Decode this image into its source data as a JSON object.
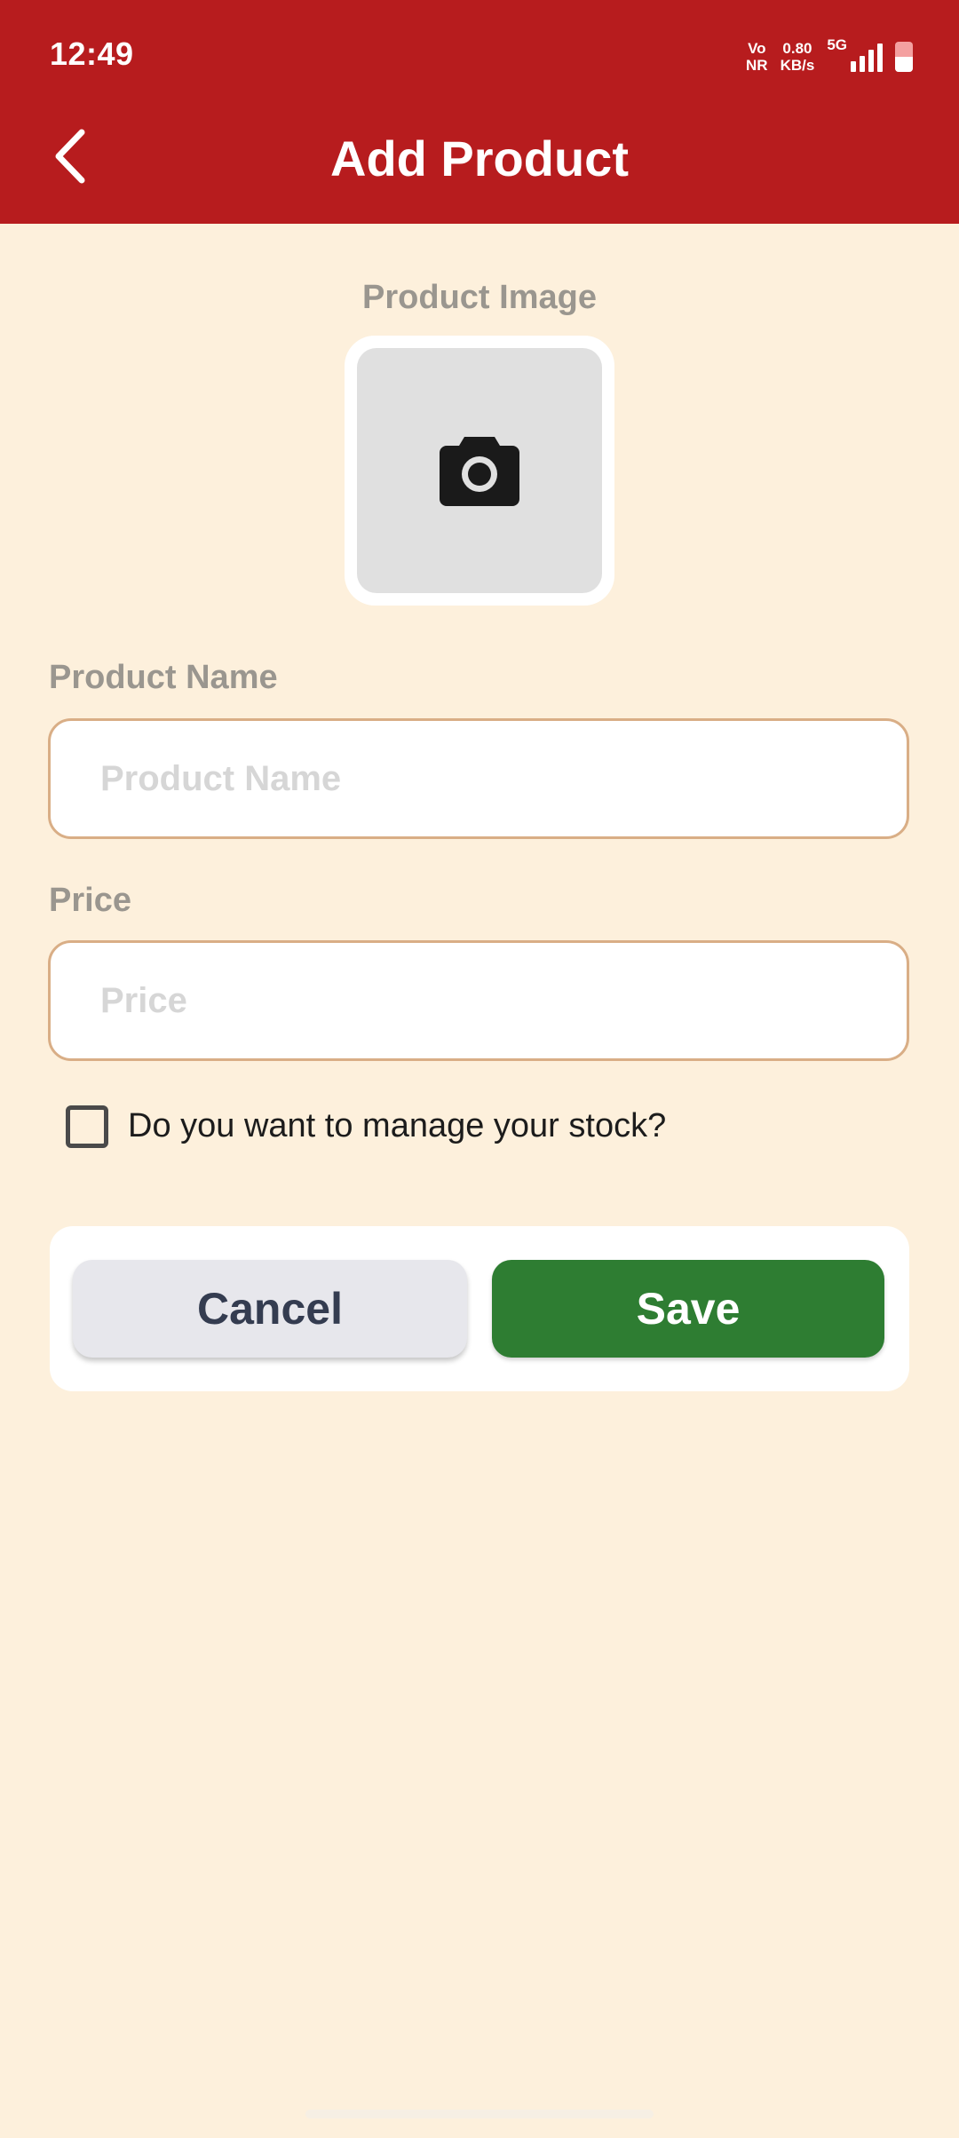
{
  "status_bar": {
    "time": "12:49",
    "volte_top": "Vo",
    "volte_bottom": "NR",
    "speed_value": "0.80",
    "speed_unit": "KB/s",
    "network": "5G",
    "battery_level": 0.5
  },
  "header": {
    "title": "Add Product",
    "back_icon": "chevron-left-icon"
  },
  "image_section": {
    "label": "Product Image",
    "icon": "camera-icon"
  },
  "product_name": {
    "label": "Product Name",
    "placeholder": "Product Name",
    "value": ""
  },
  "price": {
    "label": "Price",
    "placeholder": "Price",
    "value": ""
  },
  "stock": {
    "label": "Do you want to manage your stock?",
    "checked": false
  },
  "actions": {
    "cancel_label": "Cancel",
    "save_label": "Save"
  },
  "colors": {
    "header_bg": "#b71c1e",
    "page_bg": "#fdf0dc",
    "save_bg": "#2e7d32",
    "cancel_bg": "#e7e7ec",
    "field_border": "#d9ae86"
  }
}
